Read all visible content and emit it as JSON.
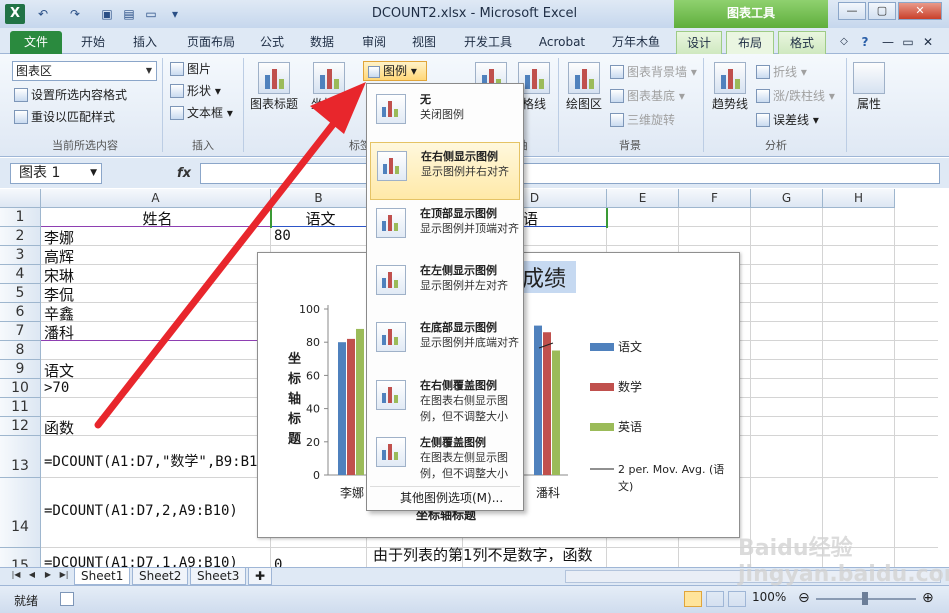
{
  "window": {
    "title": "DCOUNT2.xlsx - Microsoft Excel",
    "context_tab_group": "图表工具",
    "app_icon": "excel-icon",
    "controls": [
      "minimize-icon",
      "maximize-icon",
      "close-icon"
    ]
  },
  "tabs": [
    "文件",
    "开始",
    "插入",
    "页面布局",
    "公式",
    "数据",
    "审阅",
    "视图",
    "开发工具",
    "Acrobat",
    "万年木鱼",
    "设计",
    "布局",
    "格式"
  ],
  "active_tab": "布局",
  "ribbon": {
    "current_selection": {
      "combo": "图表区",
      "format_selection": "设置所选内容格式",
      "reset_style": "重设以匹配样式",
      "label": "当前所选内容"
    },
    "insert": {
      "picture": "图片",
      "shapes": "形状",
      "textbox": "文本框",
      "label": "插入"
    },
    "labels": {
      "chart_title": "图表标题",
      "axis_titles": "坐标轴",
      "legend": "图例",
      "partial_label": "标签",
      "gridlines": "格线",
      "axes_label": "轴",
      "label": "标签"
    },
    "background": {
      "plot_area": "绘图区",
      "chart_wall": "图表背景墙",
      "chart_floor": "图表基底",
      "rotation": "三维旋转",
      "label": "背景"
    },
    "analysis": {
      "trendline": "趋势线",
      "lines": "折线",
      "updown_bars": "涨/跌柱线",
      "error_bars": "误差线",
      "label": "分析"
    },
    "properties": {
      "label": "属性"
    }
  },
  "formula_bar": {
    "name_box": "图表 1",
    "fx": "fx",
    "formula": ""
  },
  "grid": {
    "columns": [
      "A",
      "B",
      "C",
      "D",
      "E",
      "F",
      "G",
      "H"
    ],
    "rows": [
      "1",
      "2",
      "3",
      "4",
      "5",
      "6",
      "7",
      "8",
      "9",
      "10",
      "11",
      "12",
      "13",
      "14",
      "15"
    ],
    "cells": {
      "A1": "姓名",
      "B1": "语文",
      "D1": "英语",
      "A2": "李娜",
      "B2": "80",
      "A3": "高辉",
      "A4": "宋琳",
      "A5": "李侃",
      "A6": "辛鑫",
      "A7": "潘科",
      "A9": "语文",
      "A10": ">70",
      "A12": "函数",
      "A13": "=DCOUNT(A1:D7,\"数学\",B9:B10)",
      "A14": "=DCOUNT(A1:D7,2,A9:B10)",
      "A15": "=DCOUNT(A1:D7,1,A9:B10)",
      "B15": "0",
      "C15": "由于列表的第1列不是数字，函数"
    }
  },
  "chart_data": {
    "type": "bar",
    "title": "成绩",
    "categories": [
      "李娜",
      "潘科"
    ],
    "series": [
      {
        "name": "语文",
        "color": "#4f81bd",
        "values": [
          80,
          90
        ]
      },
      {
        "name": "数学",
        "color": "#c0504d",
        "values": [
          82,
          86
        ]
      },
      {
        "name": "英语",
        "color": "#9bbb59",
        "values": [
          88,
          75
        ]
      }
    ],
    "trendline_label": "2 per. Mov. Avg. (语文)",
    "ylabel": "坐标轴标题",
    "xlabel": "坐标轴标题",
    "yticks": [
      "0",
      "20",
      "40",
      "60",
      "80",
      "100"
    ],
    "ylim": [
      0,
      100
    ]
  },
  "legend_dropdown": {
    "items": [
      {
        "title": "无",
        "desc": "关闭图例"
      },
      {
        "title": "在右侧显示图例",
        "desc": "显示图例并右对齐"
      },
      {
        "title": "在顶部显示图例",
        "desc": "显示图例并顶端对齐"
      },
      {
        "title": "在左侧显示图例",
        "desc": "显示图例并左对齐"
      },
      {
        "title": "在底部显示图例",
        "desc": "显示图例并底端对齐"
      },
      {
        "title": "在右侧覆盖图例",
        "desc": "在图表右侧显示图例，但不调整大小"
      },
      {
        "title": "左侧覆盖图例",
        "desc": "在图表左侧显示图例，但不调整大小"
      }
    ],
    "more": "其他图例选项(M)..."
  },
  "sheets": [
    "Sheet1",
    "Sheet2",
    "Sheet3"
  ],
  "active_sheet": "Sheet1",
  "status": {
    "ready": "就绪",
    "zoom": "100%"
  },
  "watermark": "Baidu经验 jingyan.baidu.com",
  "annotation_color": "#e8262c"
}
